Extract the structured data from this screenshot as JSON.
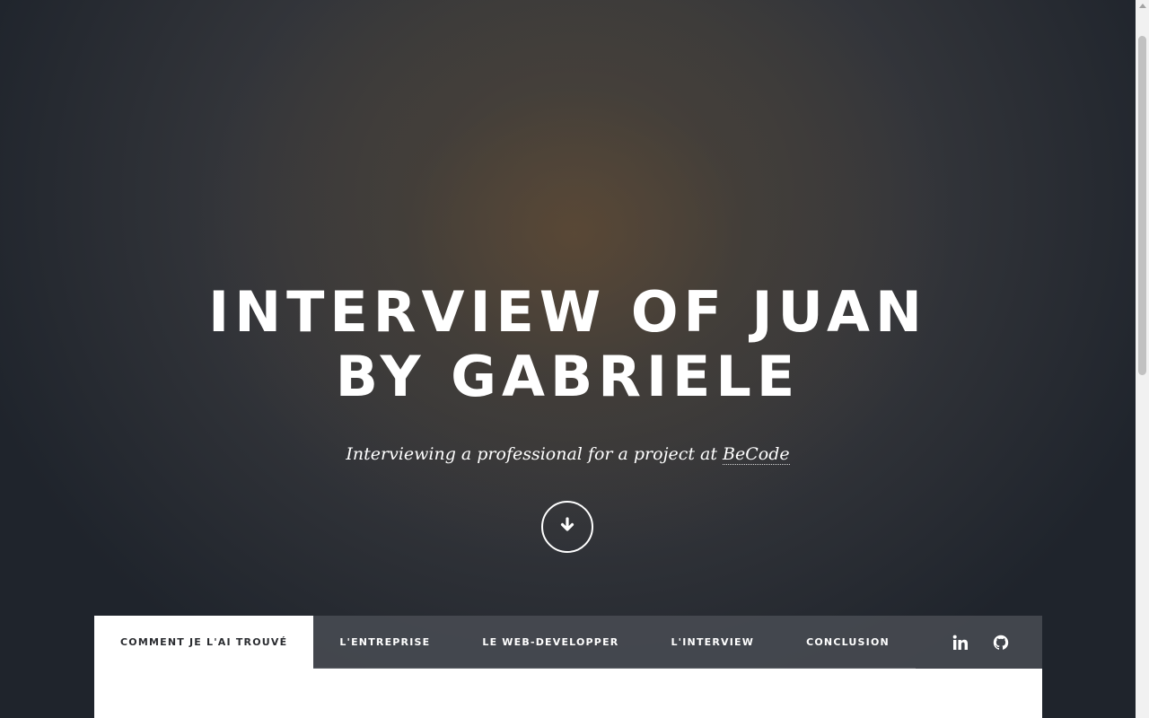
{
  "hero": {
    "title_line1": "INTERVIEW OF JUAN",
    "title_line2": "BY GABRIELE",
    "subtitle_prefix": "Interviewing a professional for a project at ",
    "subtitle_link": "BeCode",
    "scroll_icon": "arrow-down-icon"
  },
  "nav": {
    "tabs": [
      {
        "label": "COMMENT JE L'AI TROUVÉ",
        "active": true
      },
      {
        "label": "L'ENTREPRISE",
        "active": false
      },
      {
        "label": "LE WEB-DEVELOPPER",
        "active": false
      },
      {
        "label": "L'INTERVIEW",
        "active": false
      },
      {
        "label": "CONCLUSION",
        "active": false
      }
    ],
    "icons": [
      "linkedin-icon",
      "github-icon"
    ]
  },
  "colors": {
    "nav_background": "#484b52",
    "active_tab_background": "#ffffff",
    "text_light": "#ffffff",
    "text_dark": "#2a2c30"
  }
}
